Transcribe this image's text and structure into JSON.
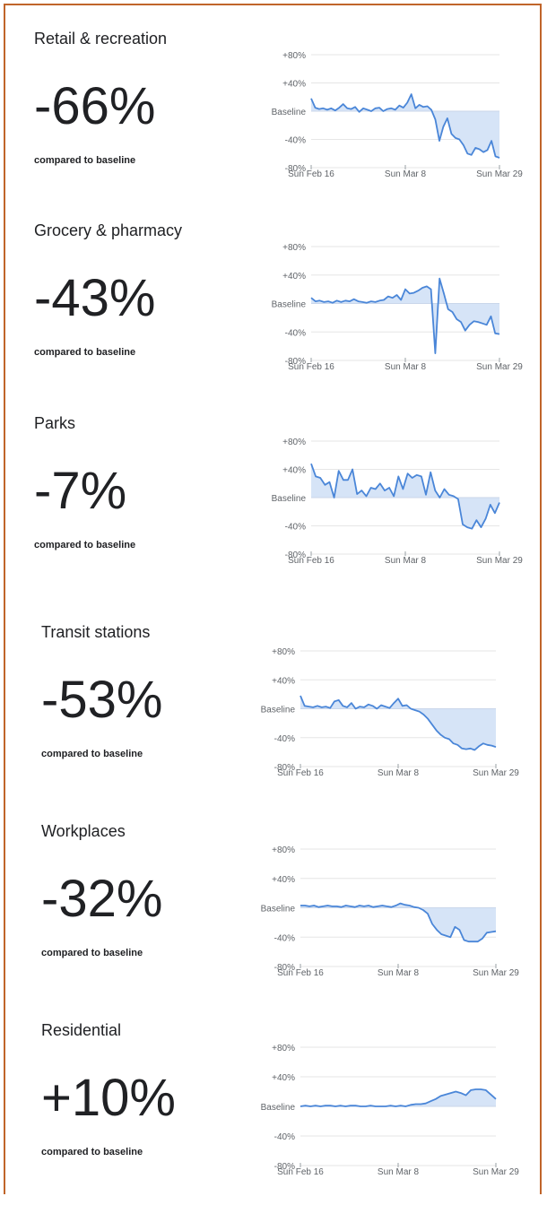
{
  "subtitle": "compared to baseline",
  "colors": {
    "line": "#4a86d8",
    "fill": "#d6e4f7",
    "grid": "#e6e6e6",
    "text": "#202124",
    "axis_text": "#5f6368",
    "border": "#c0652a"
  },
  "panels": [
    {
      "category": "Retail & recreation",
      "change": "-66%",
      "chart_data": {
        "type": "area",
        "y_ticks": [
          "+80%",
          "+40%",
          "Baseline",
          "-40%",
          "-80%"
        ],
        "x_ticks": [
          "Sun Feb 16",
          "Sun Mar 8",
          "Sun Mar 29"
        ],
        "ylim": [
          -80,
          80
        ],
        "values": [
          18,
          5,
          3,
          4,
          2,
          4,
          1,
          5,
          10,
          4,
          3,
          6,
          -1,
          4,
          2,
          0,
          4,
          5,
          0,
          3,
          4,
          2,
          8,
          5,
          12,
          24,
          4,
          9,
          6,
          7,
          2,
          -12,
          -42,
          -22,
          -10,
          -32,
          -38,
          -40,
          -48,
          -60,
          -62,
          -52,
          -54,
          -58,
          -55,
          -42,
          -64,
          -66
        ]
      }
    },
    {
      "category": "Grocery & pharmacy",
      "change": "-43%",
      "chart_data": {
        "type": "area",
        "y_ticks": [
          "+80%",
          "+40%",
          "Baseline",
          "-40%",
          "-80%"
        ],
        "x_ticks": [
          "Sun Feb 16",
          "Sun Mar 8",
          "Sun Mar 29"
        ],
        "ylim": [
          -80,
          80
        ],
        "values": [
          8,
          3,
          4,
          2,
          3,
          1,
          4,
          2,
          4,
          3,
          6,
          3,
          2,
          1,
          3,
          2,
          4,
          5,
          10,
          8,
          12,
          5,
          20,
          14,
          15,
          18,
          22,
          24,
          20,
          -70,
          35,
          14,
          -8,
          -12,
          -22,
          -26,
          -38,
          -30,
          -25,
          -26,
          -28,
          -30,
          -18,
          -42,
          -43
        ]
      }
    },
    {
      "category": "Parks",
      "change": "-7%",
      "chart_data": {
        "type": "area",
        "y_ticks": [
          "+80%",
          "+40%",
          "Baseline",
          "-40%",
          "-80%"
        ],
        "x_ticks": [
          "Sun Feb 16",
          "Sun Mar 8",
          "Sun Mar 29"
        ],
        "ylim": [
          -80,
          80
        ],
        "values": [
          48,
          30,
          28,
          18,
          22,
          0,
          38,
          25,
          25,
          40,
          5,
          10,
          2,
          14,
          12,
          20,
          10,
          14,
          2,
          30,
          12,
          34,
          28,
          32,
          30,
          4,
          36,
          10,
          0,
          12,
          4,
          2,
          -2,
          -38,
          -42,
          -44,
          -32,
          -42,
          -30,
          -10,
          -22,
          -7
        ]
      }
    },
    {
      "category": "Transit stations",
      "change": "-53%",
      "chart_data": {
        "type": "area",
        "y_ticks": [
          "+80%",
          "+40%",
          "Baseline",
          "-40%",
          "-80%"
        ],
        "x_ticks": [
          "Sun Feb 16",
          "Sun Mar 8",
          "Sun Mar 29"
        ],
        "ylim": [
          -80,
          80
        ],
        "values": [
          18,
          4,
          3,
          2,
          4,
          2,
          3,
          1,
          10,
          12,
          4,
          2,
          8,
          0,
          3,
          2,
          6,
          4,
          0,
          5,
          3,
          1,
          8,
          14,
          4,
          5,
          0,
          -2,
          -4,
          -8,
          -14,
          -22,
          -30,
          -36,
          -40,
          -42,
          -48,
          -50,
          -55,
          -56,
          -55,
          -57,
          -52,
          -48,
          -50,
          -51,
          -53
        ]
      }
    },
    {
      "category": "Workplaces",
      "change": "-32%",
      "chart_data": {
        "type": "area",
        "y_ticks": [
          "+80%",
          "+40%",
          "Baseline",
          "-40%",
          "-80%"
        ],
        "x_ticks": [
          "Sun Feb 16",
          "Sun Mar 8",
          "Sun Mar 29"
        ],
        "ylim": [
          -80,
          80
        ],
        "values": [
          3,
          3,
          2,
          3,
          1,
          2,
          3,
          2,
          2,
          1,
          3,
          2,
          1,
          3,
          2,
          3,
          1,
          2,
          3,
          2,
          1,
          3,
          6,
          4,
          3,
          1,
          0,
          -3,
          -8,
          -22,
          -30,
          -36,
          -38,
          -40,
          -26,
          -30,
          -44,
          -46,
          -46,
          -46,
          -42,
          -34,
          -33,
          -32
        ]
      }
    },
    {
      "category": "Residential",
      "change": "+10%",
      "chart_data": {
        "type": "area",
        "y_ticks": [
          "+80%",
          "+40%",
          "Baseline",
          "-40%",
          "-80%"
        ],
        "x_ticks": [
          "Sun Feb 16",
          "Sun Mar 8",
          "Sun Mar 29"
        ],
        "ylim": [
          -80,
          80
        ],
        "values": [
          0,
          1,
          0,
          1,
          0,
          1,
          1,
          0,
          1,
          0,
          1,
          1,
          0,
          0,
          1,
          0,
          0,
          0,
          1,
          0,
          1,
          0,
          2,
          3,
          3,
          4,
          7,
          10,
          14,
          16,
          18,
          20,
          18,
          15,
          22,
          23,
          23,
          22,
          16,
          10
        ]
      }
    }
  ]
}
